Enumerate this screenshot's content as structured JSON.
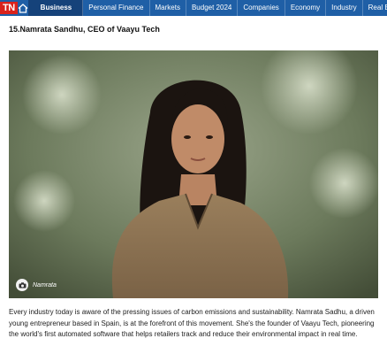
{
  "nav": {
    "logo": "TN",
    "items": [
      {
        "label": "Business",
        "active": true
      },
      {
        "label": "Personal Finance",
        "active": false
      },
      {
        "label": "Markets",
        "active": false
      },
      {
        "label": "Budget 2024",
        "active": false
      },
      {
        "label": "Companies",
        "active": false
      },
      {
        "label": "Economy",
        "active": false
      },
      {
        "label": "Industry",
        "active": false
      },
      {
        "label": "Real Estate",
        "active": false
      }
    ],
    "colors": {
      "bar": "#1f5fa6",
      "active": "#15427a",
      "logo": "#d9221c"
    }
  },
  "article": {
    "heading": "15.Namrata Sandhu, CEO of Vaayu Tech",
    "image_caption": "Namrata",
    "image_icon": "camera-icon",
    "body": "Every industry today is aware of the pressing issues of carbon emissions and sustainability. Namrata Sadhu, a driven young entrepreneur based in Spain, is at the forefront of this movement. She's the founder of Vaayu Tech, pioneering the world's first automated software that helps retailers track and reduce their environmental impact in real time."
  }
}
